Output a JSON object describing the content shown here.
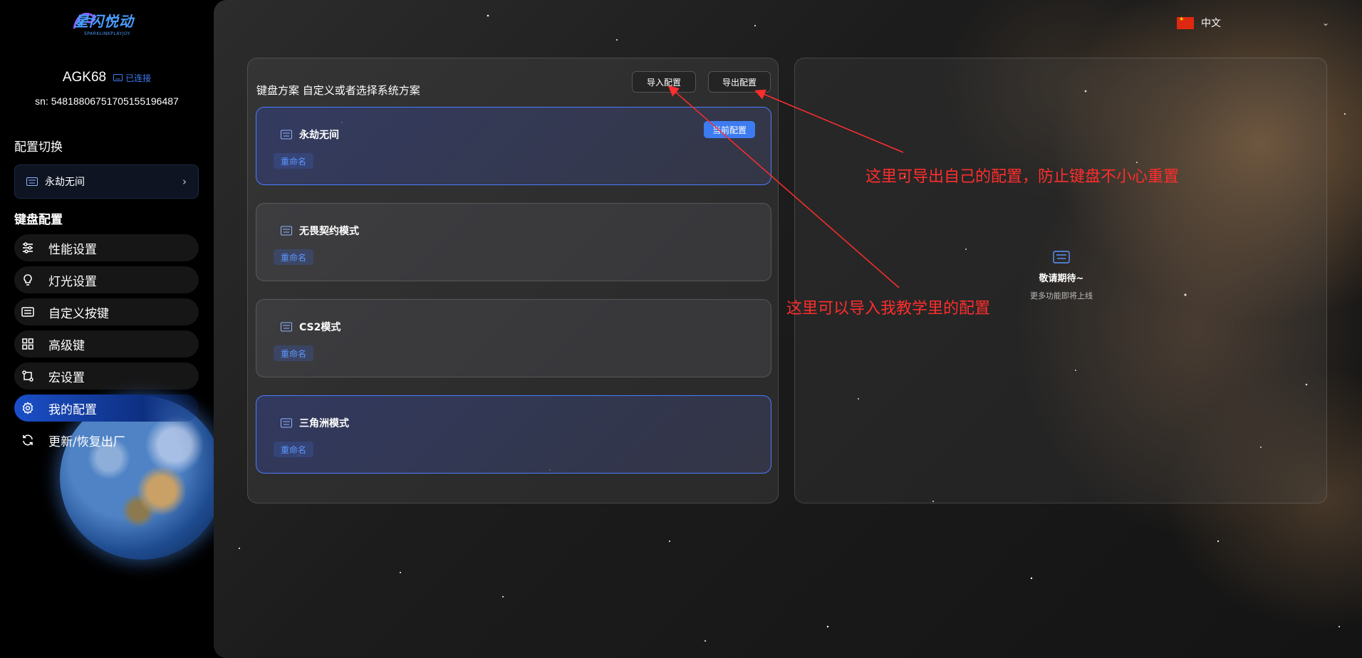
{
  "brand": {
    "logo_text": "星闪悦动",
    "logo_subtext": "SPARKLINKPLAYJOY"
  },
  "device": {
    "name": "AGK68",
    "status": "已连接",
    "sn": "sn: 548188067517051551964​87"
  },
  "sidebar": {
    "config_switch_title": "配置切换",
    "current_profile": "永劫无间",
    "keyboard_config_title": "键盘配置",
    "items": [
      {
        "label": "性能设置",
        "icon": "sliders-icon"
      },
      {
        "label": "灯光设置",
        "icon": "bulb-icon"
      },
      {
        "label": "自定义按键",
        "icon": "keyboard-icon"
      },
      {
        "label": "高级键",
        "icon": "grid-icon"
      },
      {
        "label": "宏设置",
        "icon": "macro-icon"
      },
      {
        "label": "我的配置",
        "icon": "gear-icon",
        "active": true
      },
      {
        "label": "更新/恢复出厂",
        "icon": "refresh-icon"
      }
    ]
  },
  "language": {
    "label": "中文"
  },
  "profiles_panel": {
    "heading": "键盘方案 自定义或者选择系统方案",
    "import_label": "导入配置",
    "export_label": "导出配置",
    "rename_label": "重命名",
    "current_badge": "当前配置",
    "cards": [
      {
        "name": "永劫无间",
        "current": true
      },
      {
        "name": "无畏契约模式",
        "current": false
      },
      {
        "name": "CS2模式",
        "current": false
      },
      {
        "name": "三角洲模式",
        "current": false
      }
    ]
  },
  "coming_soon": {
    "title": "敬请期待~",
    "subtitle": "更多功能即将上线"
  },
  "annotations": {
    "export_note": "这里可导出自己的配置，防止键盘不小心重置",
    "import_note": "这里可以导入我教学里的配置"
  },
  "colors": {
    "accent": "#3d7cf0",
    "annotation": "#ff2d2d"
  }
}
